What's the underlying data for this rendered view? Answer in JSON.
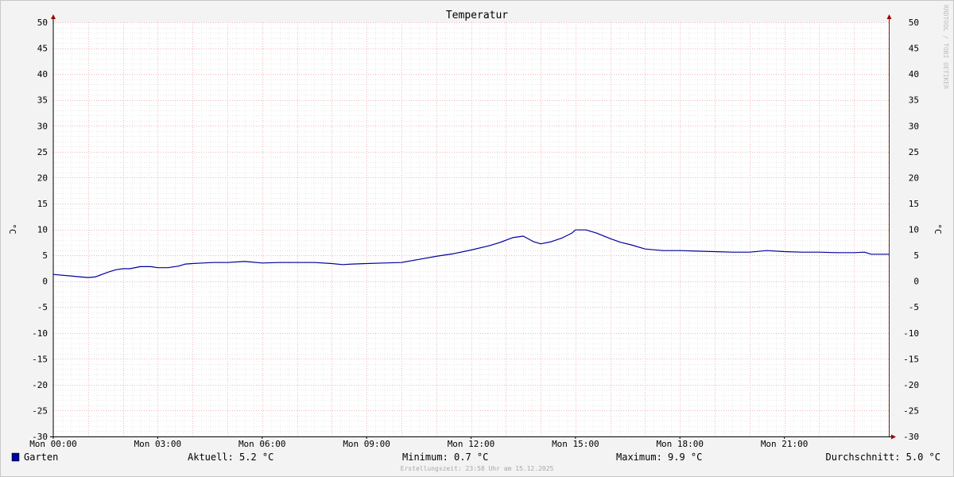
{
  "chart_data": {
    "type": "line",
    "title": "Temperatur",
    "ylabel": "°C",
    "ylabel_right": "°C",
    "ylim": [
      -30,
      50
    ],
    "y_major_step": 5,
    "y_minor_step": 1,
    "xlim": [
      0,
      24
    ],
    "x_ticks": [
      {
        "x": 0,
        "label": "Mon 00:00"
      },
      {
        "x": 3,
        "label": "Mon 03:00"
      },
      {
        "x": 6,
        "label": "Mon 06:00"
      },
      {
        "x": 9,
        "label": "Mon 09:00"
      },
      {
        "x": 12,
        "label": "Mon 12:00"
      },
      {
        "x": 15,
        "label": "Mon 15:00"
      },
      {
        "x": 18,
        "label": "Mon 18:00"
      },
      {
        "x": 21,
        "label": "Mon 21:00"
      }
    ],
    "x_major_step_hours": 1,
    "x_minor_step_hours": 0.25,
    "grid": true,
    "legend": "bottom-left",
    "watermark": "RRDTOOL / TOBI OETIKER",
    "series": [
      {
        "name": "Garten",
        "color": "#000099",
        "x": [
          0,
          0.5,
          0.8,
          1.0,
          1.2,
          1.4,
          1.6,
          1.8,
          2.0,
          2.2,
          2.5,
          2.8,
          3.0,
          3.3,
          3.6,
          3.8,
          4.0,
          4.3,
          4.6,
          5.0,
          5.5,
          6.0,
          6.5,
          7.0,
          7.5,
          8.0,
          8.3,
          8.6,
          9.0,
          9.5,
          10.0,
          10.5,
          11.0,
          11.5,
          12.0,
          12.5,
          12.8,
          13.0,
          13.2,
          13.5,
          13.8,
          14.0,
          14.3,
          14.6,
          14.9,
          15.0,
          15.3,
          15.6,
          16.0,
          16.3,
          16.6,
          17.0,
          17.5,
          18.0,
          18.5,
          19.0,
          19.5,
          20.0,
          20.5,
          21.0,
          21.5,
          22.0,
          22.5,
          23.0,
          23.3,
          23.5,
          24.0
        ],
        "values": [
          1.3,
          1.0,
          0.8,
          0.7,
          0.8,
          1.3,
          1.8,
          2.2,
          2.4,
          2.4,
          2.8,
          2.8,
          2.6,
          2.6,
          2.9,
          3.3,
          3.4,
          3.5,
          3.6,
          3.6,
          3.8,
          3.5,
          3.6,
          3.6,
          3.6,
          3.4,
          3.2,
          3.3,
          3.4,
          3.5,
          3.6,
          4.2,
          4.8,
          5.3,
          6.0,
          6.8,
          7.4,
          7.9,
          8.4,
          8.7,
          7.6,
          7.2,
          7.6,
          8.3,
          9.3,
          9.9,
          9.9,
          9.3,
          8.2,
          7.5,
          7.0,
          6.2,
          5.9,
          5.9,
          5.8,
          5.7,
          5.6,
          5.6,
          5.9,
          5.7,
          5.6,
          5.6,
          5.5,
          5.5,
          5.6,
          5.2,
          5.2
        ]
      }
    ]
  },
  "legend": {
    "series_name": "Garten",
    "color": "#000099",
    "current": "Aktuell: 5.2 °C",
    "minimum": "Minimum: 0.7 °C",
    "maximum": "Maximum: 9.9 °C",
    "average": "Durchschnitt: 5.0 °C"
  },
  "footer": "Erstellungszeit: 23:58 Uhr am 15.12.2025"
}
